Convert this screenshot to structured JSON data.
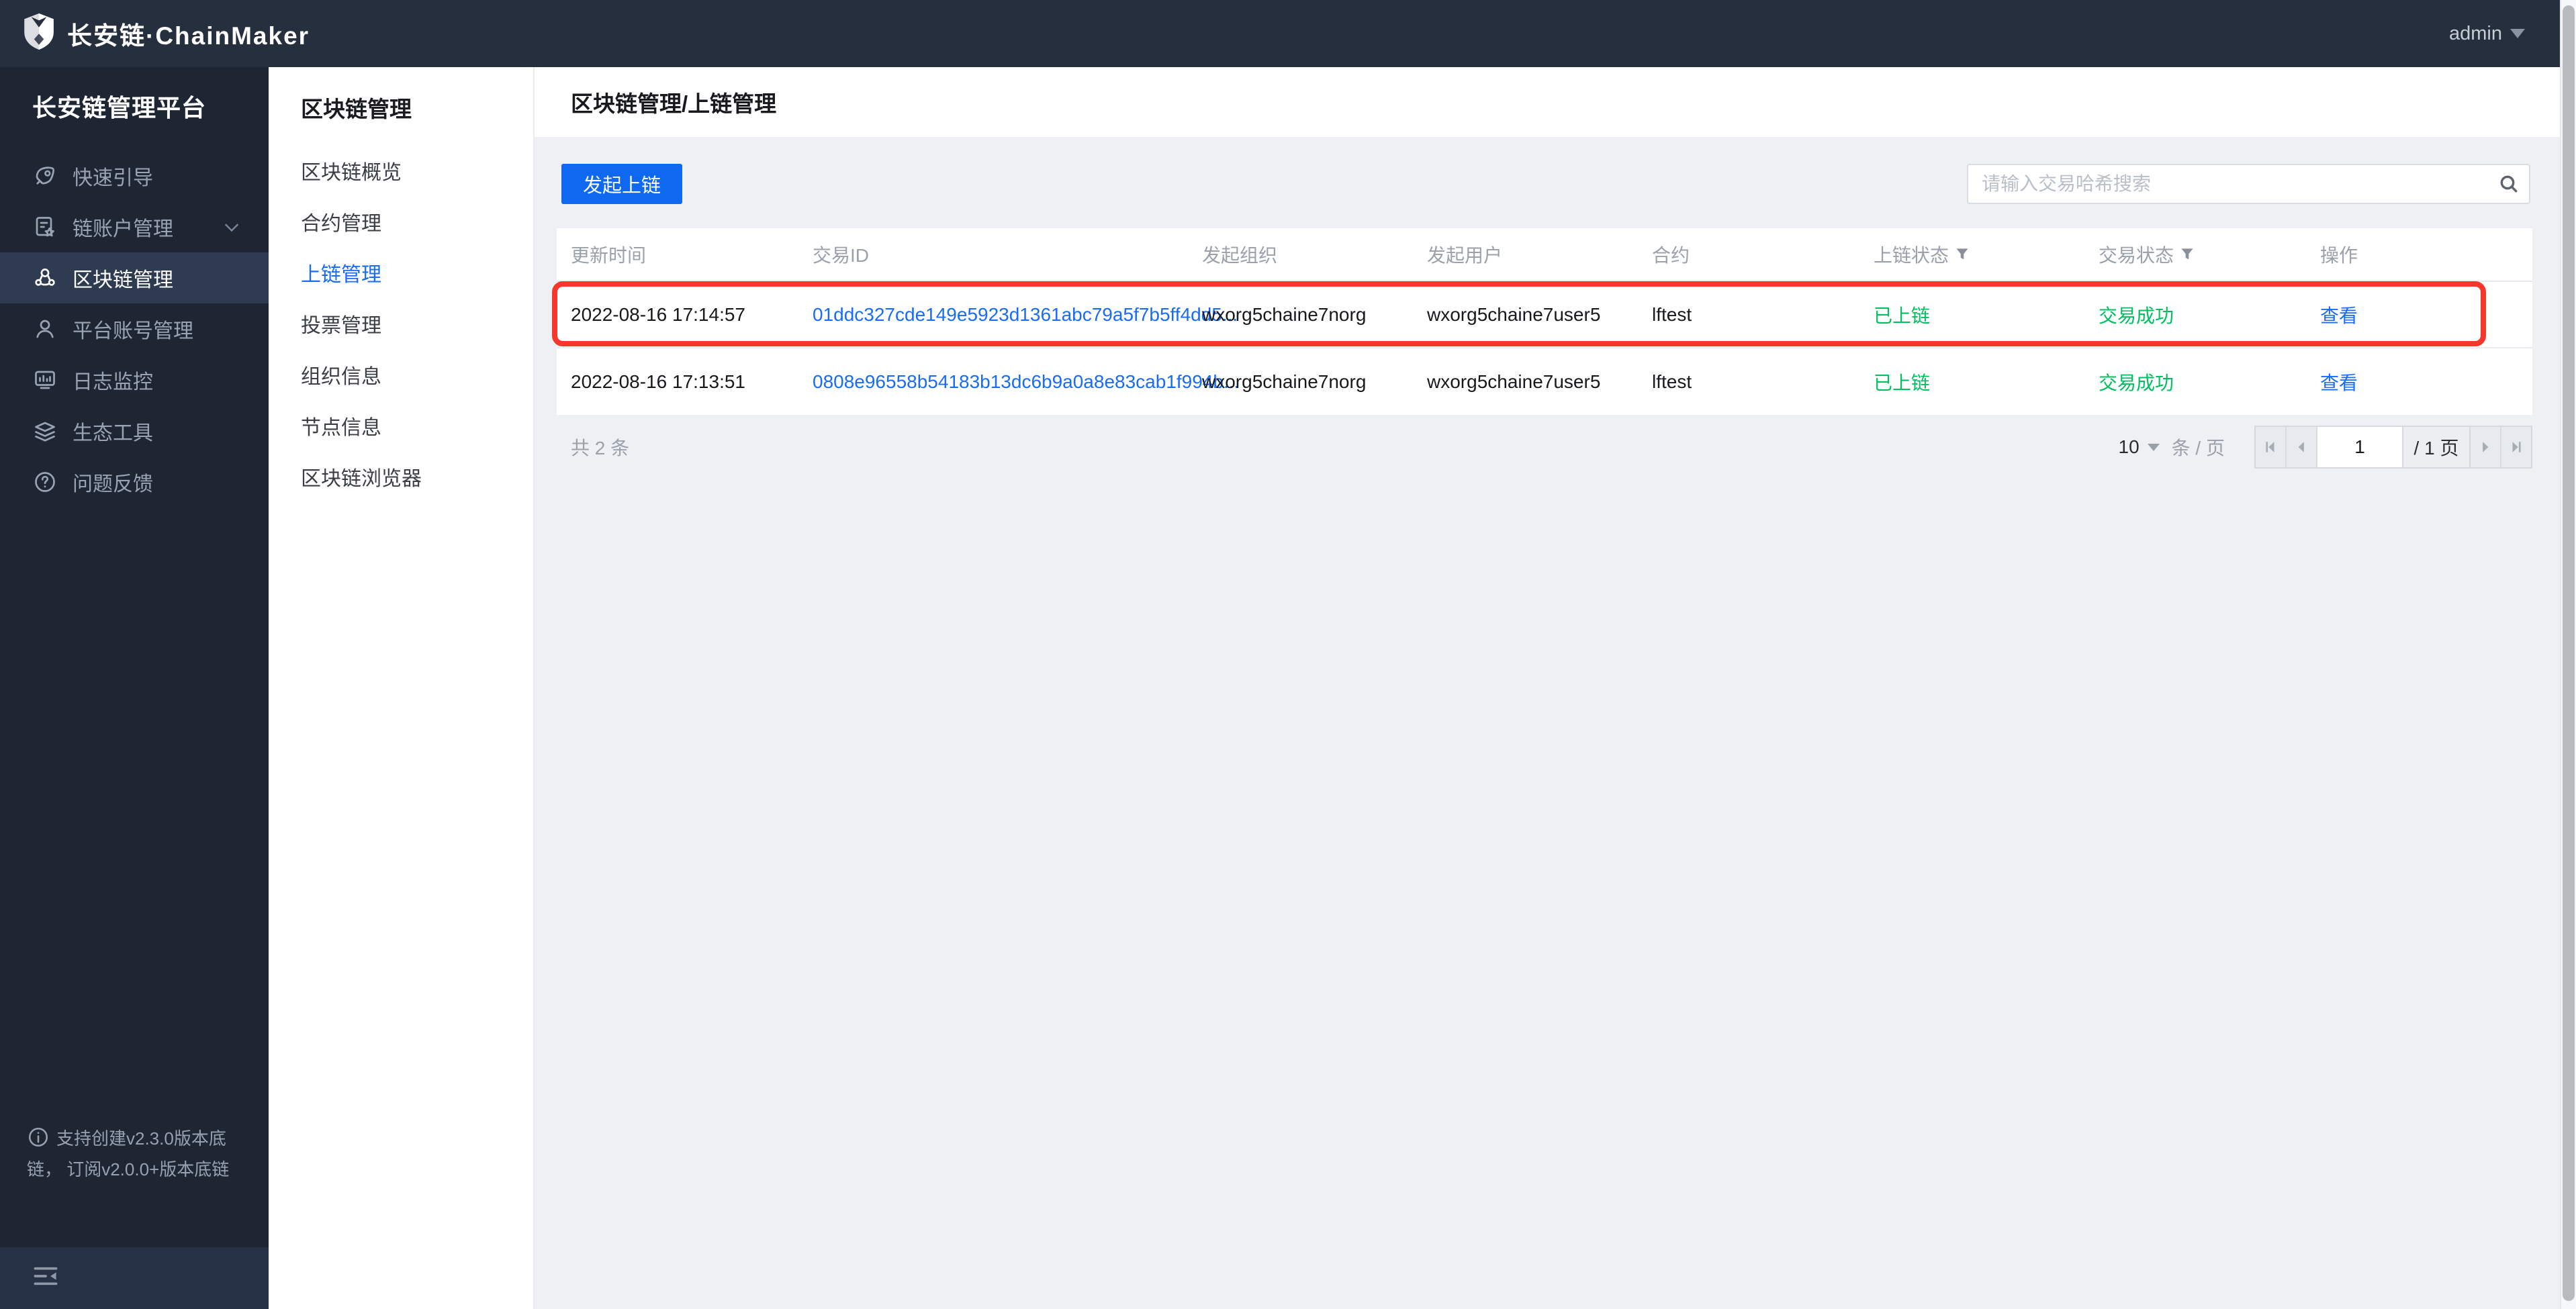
{
  "header": {
    "logo_text": "长安链·ChainMaker",
    "user": "admin"
  },
  "sidebar": {
    "title": "长安链管理平台",
    "items": [
      {
        "label": "快速引导",
        "icon": "rocket-icon"
      },
      {
        "label": "链账户管理",
        "icon": "account-doc-icon",
        "has_chevron": true
      },
      {
        "label": "区块链管理",
        "icon": "blockchain-icon",
        "selected": true
      },
      {
        "label": "平台账号管理",
        "icon": "user-icon"
      },
      {
        "label": "日志监控",
        "icon": "monitor-icon"
      },
      {
        "label": "生态工具",
        "icon": "layers-icon"
      },
      {
        "label": "问题反馈",
        "icon": "question-icon"
      }
    ],
    "footer_note": "支持创建v2.3.0版本底链， 订阅v2.0.0+版本底链"
  },
  "submenu": {
    "title": "区块链管理",
    "items": [
      {
        "label": "区块链概览"
      },
      {
        "label": "合约管理"
      },
      {
        "label": "上链管理",
        "selected": true
      },
      {
        "label": "投票管理"
      },
      {
        "label": "组织信息"
      },
      {
        "label": "节点信息"
      },
      {
        "label": "区块链浏览器"
      }
    ]
  },
  "breadcrumb": "区块链管理/上链管理",
  "toolbar": {
    "launch_button": "发起上链",
    "search_placeholder": "请输入交易哈希搜索"
  },
  "table": {
    "columns": [
      "更新时间",
      "交易ID",
      "发起组织",
      "发起用户",
      "合约",
      "上链状态",
      "交易状态",
      "操作"
    ],
    "filtered_columns": [
      "上链状态",
      "交易状态"
    ],
    "rows": [
      {
        "time": "2022-08-16 17:14:57",
        "tx_id": "01ddc327cde149e5923d1361abc79a5f7b5ff4dd5...",
        "org": "wxorg5chaine7norg",
        "user": "wxorg5chaine7user5",
        "contract": "lftest",
        "chain_status": "已上链",
        "tx_status": "交易成功",
        "action": "查看",
        "highlighted": true
      },
      {
        "time": "2022-08-16 17:13:51",
        "tx_id": "0808e96558b54183b13dc6b9a0a8e83cab1f994b...",
        "org": "wxorg5chaine7norg",
        "user": "wxorg5chaine7user5",
        "contract": "lftest",
        "chain_status": "已上链",
        "tx_status": "交易成功",
        "action": "查看",
        "highlighted": false
      }
    ]
  },
  "pagination": {
    "total_text": "共 2 条",
    "page_size": "10",
    "per_page_label": "条 / 页",
    "page_input": "1",
    "page_total_label": "/ 1 页"
  },
  "colors": {
    "header_bg": "#262f3e",
    "sidebar_bg": "#1e2634",
    "sidebar_selected_bg": "#2e3b50",
    "accent_blue": "#0f68f0",
    "link_blue": "#1a6cf5",
    "success_green": "#00bf5f",
    "annotation_red": "#f5382b",
    "content_bg": "#eef0f4"
  }
}
